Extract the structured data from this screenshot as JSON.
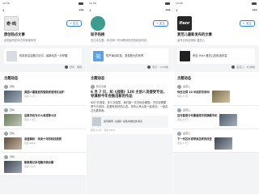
{
  "status": {
    "time1": "10:56",
    "time2": "10:56",
    "time3": "10:56"
  },
  "nav": {
    "back_glyph": "‹",
    "more_glyph": "•••"
  },
  "panel1": {
    "logo_text": "奇·鸣",
    "follow_label": "+ 关注",
    "title": "原创热点文章",
    "desc": "全国最有影响力的新媒体号",
    "card_logo": "奇妙",
    "card_text": "科技前沿话题讨论中，最新动态一手掌握",
    "source_text": "奇鸣 · 刚刚",
    "section": "主题动态",
    "items": [
      {
        "name": "奇鸣",
        "text": "美国人最喜爱的智能家居排名出炉",
        "meta": "阅读 2.1万"
      },
      {
        "name": "奇鸣",
        "text": "这款手机为什么卖得那么好",
        "meta": "阅读 1.8万"
      },
      {
        "name": "奇鸣",
        "text": "深度解析：未来十年的科技趋势",
        "meta": "阅读 9856"
      },
      {
        "name": "奇鸣",
        "text": "新款笔记本电脑评测合集",
        "meta": "阅读 7432"
      }
    ]
  },
  "panel2": {
    "follow_label": "+ 关注",
    "title": "知乎热榜",
    "desc": "关注本主题，你将第一时间看到相关的精选内容",
    "card_logo": "知",
    "card_text": "知乎每日精选，发现更大的世界",
    "source_text": "知乎 · 1小时前",
    "section": "主题动态",
    "post_name": "知乎日报",
    "post_title": "6 月 7 日，如《战狼》120 主创人员接受专访，导演称今年会推出新的作品",
    "post_body": "6月7日消息，多少次回答，我们能一次次地去解答。不仅仅需要勇气与坚持，还要有良好的心态。多年以来大家一起成长，一起走过无数风雨。",
    "link_text": "如何看待《战狼》续集将推出的消息",
    "post_meta": "赞同 2.4万 · 评论 1832"
  },
  "panel3": {
    "logo_text": "ifanr",
    "follow_label": "+ 关注",
    "title": "爱范儿最新发布的文章",
    "desc": "最专业科技媒体 爱范儿",
    "card_text": "来自 ifanr 爱范儿的精选内容",
    "source_text": "爱范儿 · 3分钟前",
    "section": "主题动态",
    "items": [
      {
        "name": "爱范儿",
        "text": "你还记得 10 年前的手机吗",
        "meta": "阅读 3.2万"
      },
      {
        "name": "爱范儿",
        "text": "这可能是今年最值得买的旗舰手机",
        "meta": "阅读 2.6万"
      },
      {
        "name": "爱范儿",
        "text": "下一代芯片将带来怎样的改变",
        "meta": "阅读 1.5万"
      }
    ]
  }
}
